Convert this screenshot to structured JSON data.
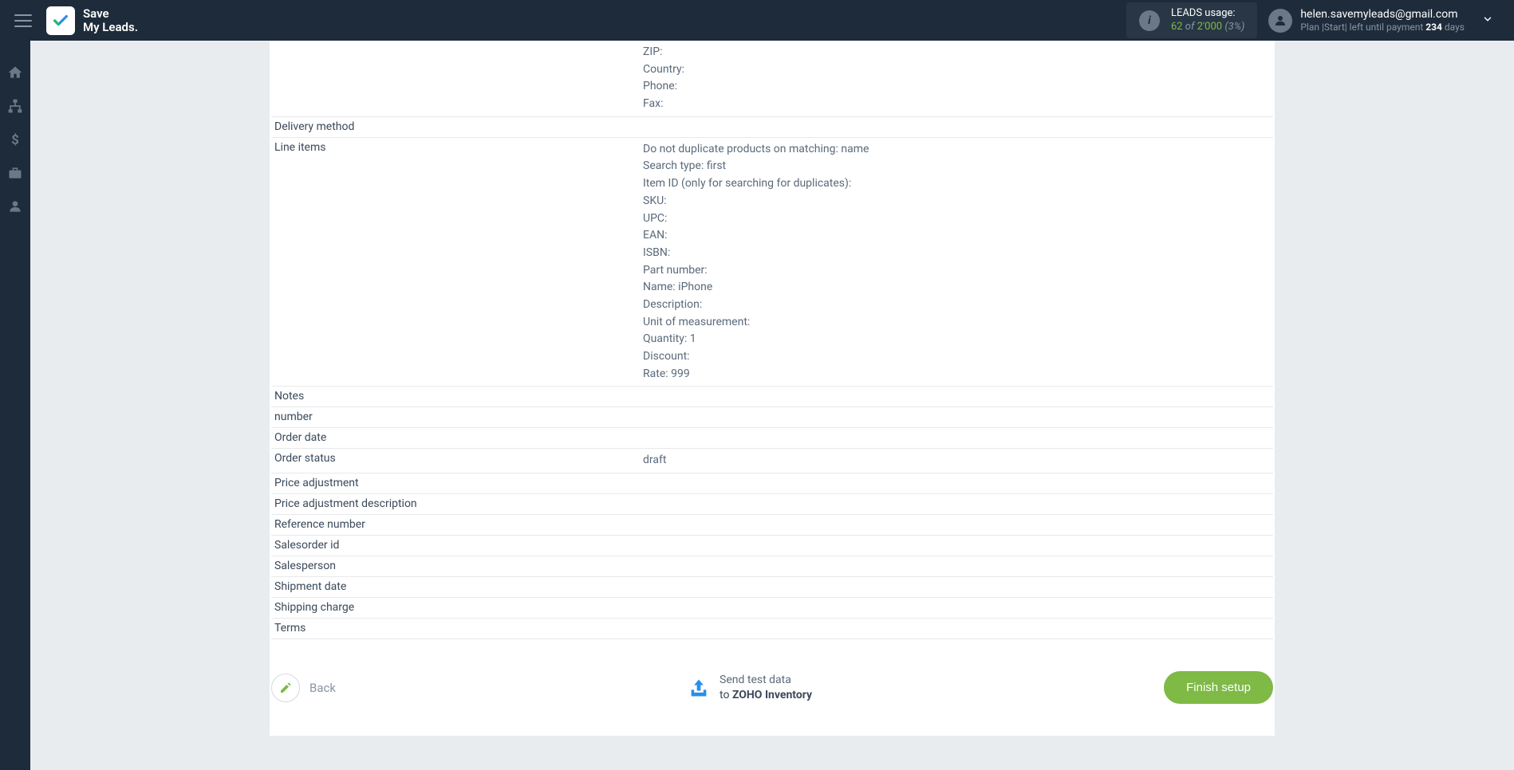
{
  "header": {
    "logo_line1": "Save",
    "logo_line2": "My Leads.",
    "usage_label": "LEADS usage:",
    "usage_current": "62",
    "usage_of": "of",
    "usage_total": "2'000",
    "usage_pct": "(3%)",
    "user_email": "helen.savemyleads@gmail.com",
    "plan_text_1": "Plan |Start| left until payment ",
    "plan_days": "234",
    "plan_text_2": " days"
  },
  "rows_top": [
    {
      "label": "",
      "lines": [
        "ZIP:",
        "Country:",
        "Phone:",
        "Fax:"
      ]
    },
    {
      "label": "Delivery method",
      "lines": []
    },
    {
      "label": "Line items",
      "lines": [
        "Do not duplicate products on matching: name",
        "Search type: first",
        "Item ID (only for searching for duplicates):",
        "SKU:",
        "UPC:",
        "EAN:",
        "ISBN:",
        "Part number:",
        "Name: iPhone",
        "Description:",
        "Unit of measurement:",
        "Quantity: 1",
        "Discount:",
        "Rate: 999"
      ]
    }
  ],
  "rows_simple": [
    {
      "label": "Notes",
      "value": ""
    },
    {
      "label": "number",
      "value": ""
    },
    {
      "label": "Order date",
      "value": ""
    },
    {
      "label": "Order status",
      "value": "draft"
    },
    {
      "label": "Price adjustment",
      "value": ""
    },
    {
      "label": "Price adjustment description",
      "value": ""
    },
    {
      "label": "Reference number",
      "value": ""
    },
    {
      "label": "Salesorder id",
      "value": ""
    },
    {
      "label": "Salesperson",
      "value": ""
    },
    {
      "label": "Shipment date",
      "value": ""
    },
    {
      "label": "Shipping charge",
      "value": ""
    },
    {
      "label": "Terms",
      "value": ""
    }
  ],
  "footer": {
    "back": "Back",
    "send_line1": "Send test data",
    "send_line2_a": "to ",
    "send_line2_b": "ZOHO Inventory",
    "finish": "Finish setup"
  }
}
